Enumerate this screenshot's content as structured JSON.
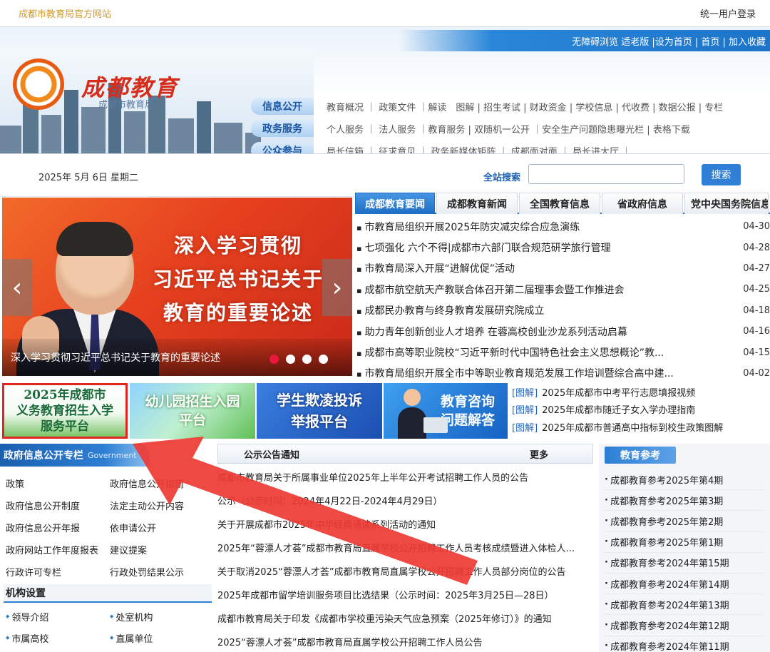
{
  "topbar": {
    "site_name": "成都市教育局官方网站",
    "login": "统一用户登录"
  },
  "header": {
    "title": "成都教育",
    "subtitle": "成都市教育局",
    "top_links": "无障碍浏览 适老版 |设为首页 | 首页 | 加入收藏",
    "nav": [
      {
        "tag": "信息公开",
        "links": "教育概况 ｜ 政策文件 ｜解读　图解 | 招生考试 | 财政资金 | 学校信息 | 代收费 | 数据公报 | 专栏"
      },
      {
        "tag": "政务服务",
        "links": "个人服务 ｜ 法人服务 ｜教育服务 | 双随机一公开 ｜安全生产问题隐患曝光栏 | 表格下载"
      },
      {
        "tag": "公众参与",
        "links": "局长信箱 ｜ 征求意见 ｜ 政务新媒体矩阵 ｜ 成都面对面 ｜ 局长进大厅 ｜"
      }
    ]
  },
  "daterow": {
    "date": "2025年 5月 6日 星期二",
    "search_label": "全站搜索",
    "search_value": "",
    "search_button": "搜索"
  },
  "banner": {
    "slogan": [
      "深入学习贯彻",
      "习近平总书记关于",
      "教育的重要论述"
    ],
    "caption": "深入学习贯彻习近平总书记关于教育的重要论述",
    "prev": "‹",
    "next": "›",
    "dots": 4,
    "active_dot": 1
  },
  "news": {
    "tabs": [
      "成都教育要闻",
      "成都教育新闻",
      "全国教育信息",
      "省政府信息",
      "党中央国务院信息"
    ],
    "active_tab": 0,
    "items": [
      {
        "title": "市教育局组织开展2025年防灾减灾综合应急演练",
        "date": "04-30"
      },
      {
        "title": "七项强化 六个不得|成都市六部门联合规范研学旅行管理",
        "date": "04-28"
      },
      {
        "title": "市教育局深入开展“进解优促”活动",
        "date": "04-27"
      },
      {
        "title": "成都市航空航天产教联合体召开第二届理事会暨工作推进会",
        "date": "04-25"
      },
      {
        "title": "成都民办教育与终身教育发展研究院成立",
        "date": "04-18"
      },
      {
        "title": "助力青年创新创业人才培养 在蓉高校创业沙龙系列活动启幕",
        "date": "04-16"
      },
      {
        "title": "成都市高等职业院校“习近平新时代中国特色社会主义思想概论”教...",
        "date": "04-15"
      },
      {
        "title": "市教育局组织开展全市中等职业教育规范发展工作培训暨综合高中建...",
        "date": "04-02"
      }
    ]
  },
  "promos": [
    {
      "lines": [
        "2025年成都市",
        "义务教育招生入学",
        "服务平台"
      ]
    },
    {
      "lines": [
        "幼儿园招生入园",
        "平台"
      ]
    },
    {
      "lines": [
        "学生欺凌投诉",
        "举报平台"
      ]
    },
    {
      "lines": [
        "教育咨询",
        "问题解答"
      ]
    }
  ],
  "tujie": [
    {
      "tag": "[图解]",
      "title": "2025年成都市中考平行志愿填报视频"
    },
    {
      "tag": "[图解]",
      "title": "2025年成都市随迁子女入学办理指南"
    },
    {
      "tag": "[图解]",
      "title": "2025年成都市普通高中指标到校生政策图解"
    }
  ],
  "gov": {
    "title": "政府信息公开专栏",
    "title_en": "Government",
    "items": [
      "政策",
      "政府信息公开指南",
      "政府信息公开制度",
      "法定主动公开内容",
      "政府信息公开年报",
      "依申请公开",
      "政府网站工作年度报表",
      "建议提案",
      "行政许可专栏",
      "行政处罚结果公示"
    ],
    "org_title": "机构设置",
    "org_items": [
      "领导介绍",
      "处室机构",
      "市属高校",
      "直属单位"
    ]
  },
  "notice": {
    "title": "公示公告通知",
    "more": "更多",
    "items": [
      "成都市教育局关于所属事业单位2025年上半年公开考试招聘工作人员的公告",
      "公示（公示时间：2024年4月22日-2024年4月29日）",
      "关于开展成都市2025年中华经典诵读系列活动的通知",
      "2025年“蓉漂人才荟”成都市教育局直属学校公开招聘工作人员考核成绩暨进入体检人...",
      "关于取消2025“蓉漂人才荟”成都市教育局直属学校公开招聘工作人员部分岗位的公告",
      "2025年成都市留学培训服务项目比选结果（公示时间：2025年3月25日—28日）",
      "成都市教育局关于印发《成都市学校重污染天气应急预案（2025年修订）》的通知",
      "2025“蓉漂人才荟”成都市教育局直属学校公开招聘工作人员公告"
    ]
  },
  "ref": {
    "title": "教育参考",
    "items": [
      "成都教育参考2025年第4期",
      "成都教育参考2025年第3期",
      "成都教育参考2025年第2期",
      "成都教育参考2025年第1期",
      "成都教育参考2024年第15期",
      "成都教育参考2024年第14期",
      "成都教育参考2024年第13期",
      "成都教育参考2024年第12期",
      "成都教育参考2024年第11期"
    ]
  },
  "colors": {
    "accent_blue": "#1e6fc4",
    "highlight_red": "#e0251f",
    "title_red": "#d62c1c"
  }
}
